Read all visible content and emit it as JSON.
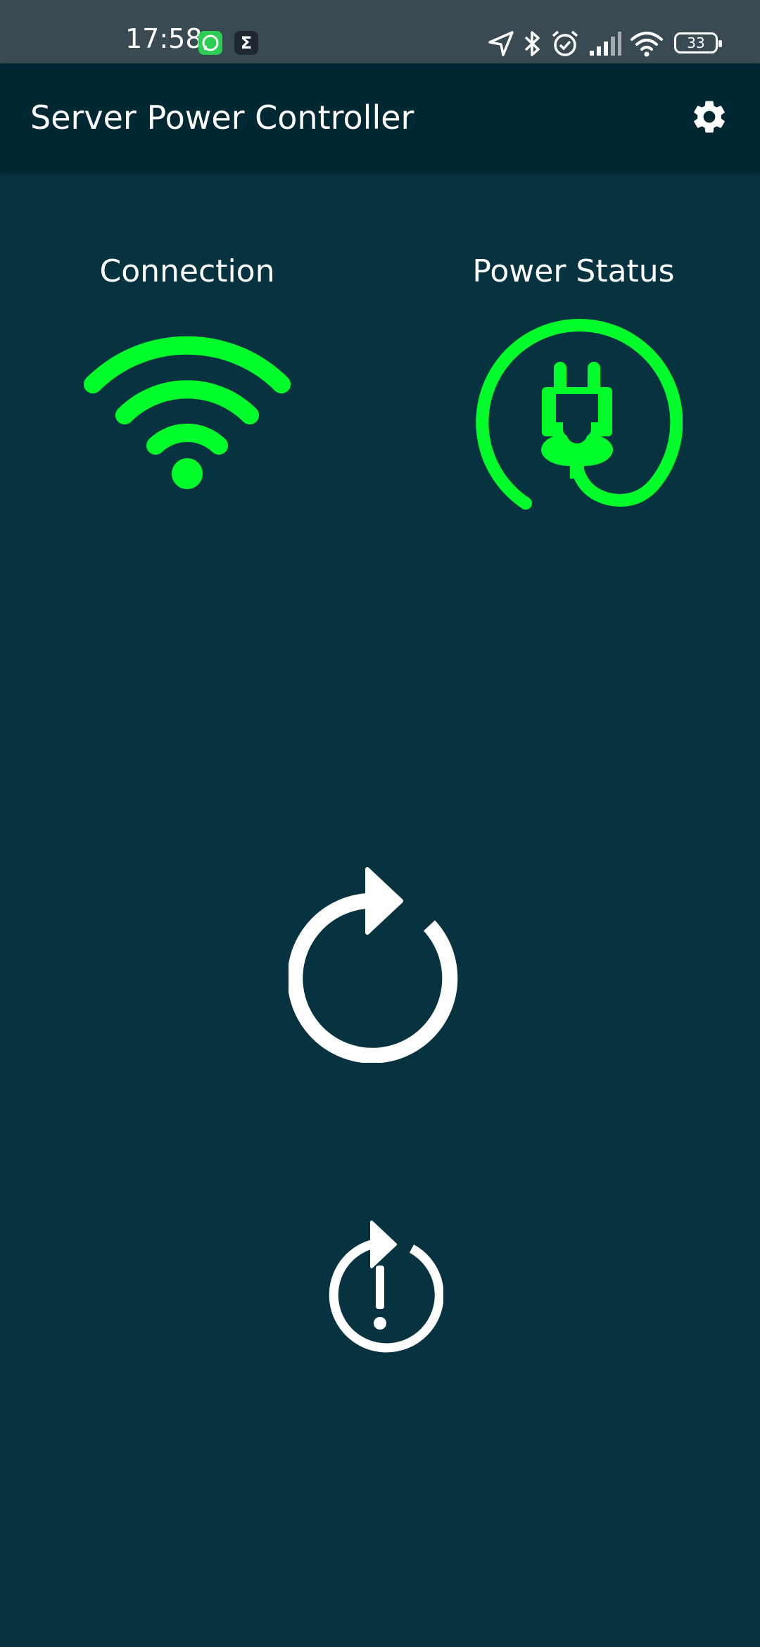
{
  "status_bar": {
    "time": "17:58",
    "battery": "33",
    "notification_icons": [
      "whatsapp-icon",
      "sigma-icon"
    ],
    "status_icons": [
      "location-icon",
      "bluetooth-icon",
      "alarm-icon",
      "cell-signal-icon",
      "wifi-icon",
      "battery-icon"
    ]
  },
  "app_bar": {
    "title": "Server Power Controller",
    "settings_icon": "gear-icon"
  },
  "indicators": {
    "connection_label": "Connection",
    "connection_icon": "wifi-icon",
    "power_label": "Power Status",
    "power_icon": "plug-icon"
  },
  "actions": {
    "restart_icon": "restart-icon",
    "force_restart_icon": "force-restart-icon"
  },
  "colors": {
    "background": "#073340",
    "app_bar": "#002833",
    "status_ok": "#00ff2a",
    "foreground": "#ffffff"
  }
}
